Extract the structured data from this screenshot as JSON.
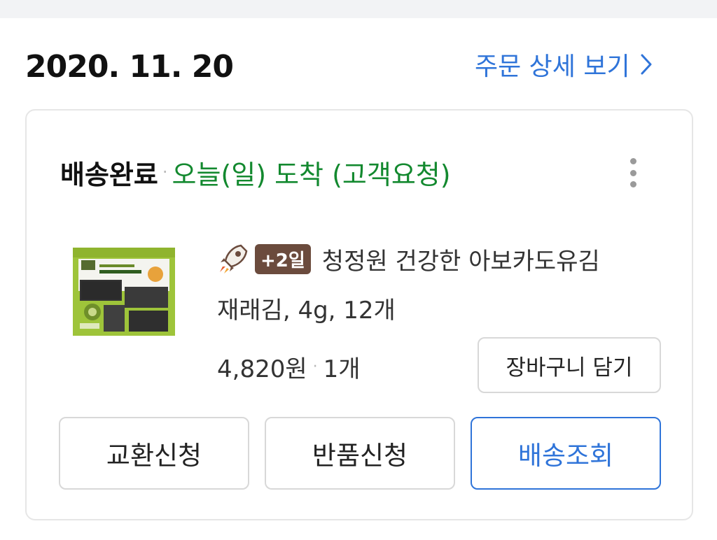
{
  "order": {
    "date": "2020. 11. 20",
    "detail_link": "주문 상세 보기"
  },
  "status": {
    "main": "배송완료",
    "separator": "·",
    "arrival": "오늘(일) 도착 (고객요청)"
  },
  "product": {
    "badge": "+2일",
    "name_line1": "청정원 건강한 아보카도유김",
    "name_line2": "재래김, 4g, 12개",
    "price": "4,820원",
    "separator": "·",
    "quantity": "1개",
    "cart_button": "장바구니 담기"
  },
  "actions": {
    "exchange": "교환신청",
    "return": "반품신청",
    "track": "배송조회"
  },
  "icons": {
    "detail_arrow": "chevron-right-icon",
    "more": "kebab-menu-icon",
    "rocket": "rocket-icon"
  },
  "colors": {
    "accent_blue": "#2f74d9",
    "arrival_green": "#13892f",
    "badge_brown": "#6b4b3d"
  }
}
